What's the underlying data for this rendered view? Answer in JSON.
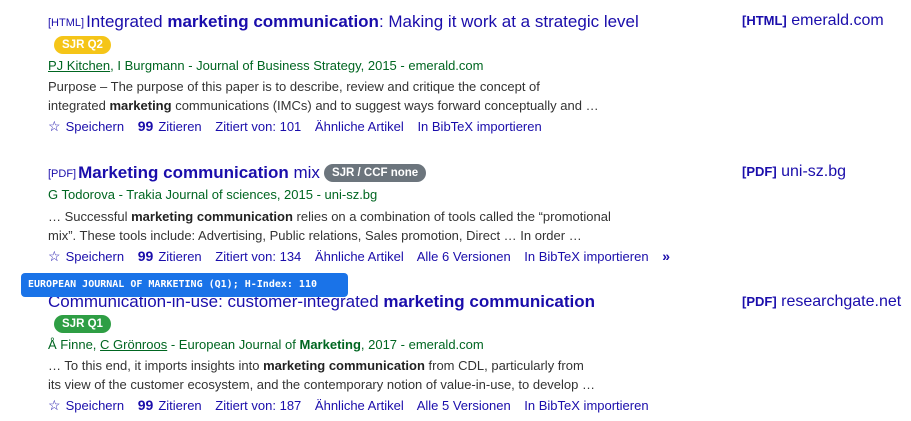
{
  "results": [
    {
      "type_tag": "[HTML]",
      "title_pre": "Integrated ",
      "title_bold": "marketing communication",
      "title_post": ": Making it work at a strategic level",
      "badge": "SJR Q2",
      "author1": "PJ Kitchen",
      "authors_rest": ", I Burgmann - Journal of Business Strategy, 2015 - emerald.com",
      "snippet_l1": "Purpose – The purpose of this paper is to describe, review and critique the concept of",
      "snippet_l2_pre": "integrated ",
      "snippet_l2_bold": "marketing",
      "snippet_l2_post": " communications (IMCs) and to suggest ways forward conceptually and …",
      "actions": {
        "save": "Speichern",
        "cite": "Zitieren",
        "cited": "Zitiert von: 101",
        "related": "Ähnliche Artikel",
        "bibtex": "In BibTeX importieren"
      },
      "side_tag": "[HTML]",
      "side_domain": "emerald.com"
    },
    {
      "type_tag": "[PDF]",
      "title_bold": "Marketing communication",
      "title_post": " mix",
      "badge": "SJR / CCF none",
      "authors": "G Todorova - Trakia Journal of sciences, 2015 - uni-sz.bg",
      "snippet_l1_pre": "… Successful ",
      "snippet_l1_bold": "marketing communication",
      "snippet_l1_post": " relies on a combination of tools called the “promotional",
      "snippet_l2": "mix”. These tools include: Advertising, Public relations, Sales promotion, Direct … In order …",
      "actions": {
        "save": "Speichern",
        "cite": "Zitieren",
        "cited": "Zitiert von: 134",
        "related": "Ähnliche Artikel",
        "versions": "Alle 6 Versionen",
        "bibtex": "In BibTeX importieren"
      },
      "side_tag": "[PDF]",
      "side_domain": "uni-sz.bg"
    },
    {
      "title_pre": "Communication-in-use: customer-integrated ",
      "title_bold": "marketing communication",
      "badge": "SJR Q1",
      "authors_pre": "Å Finne, ",
      "author2": "C Grönroos",
      "authors_mid": " - European Journal of ",
      "authors_bold": "Marketing",
      "authors_post": ", 2017 - emerald.com",
      "snippet_l1_pre": "… To this end, it imports insights into ",
      "snippet_l1_bold": "marketing communication",
      "snippet_l1_post": " from CDL, particularly from",
      "snippet_l2": "its view of the customer ecosystem, and the contemporary notion of value-in-use, to develop …",
      "actions": {
        "save": "Speichern",
        "cite": "Zitieren",
        "cited": "Zitiert von: 187",
        "related": "Ähnliche Artikel",
        "versions": "Alle 5 Versionen",
        "bibtex": "In BibTeX importieren"
      },
      "side_tag": "[PDF]",
      "side_domain": "researchgate.net"
    }
  ],
  "tooltip": "EUROPEAN JOURNAL OF MARKETING (Q1); H-Index: 110",
  "colors": {
    "link": "#1a0dab",
    "green": "#006621",
    "badge_q2": "#f5c518",
    "badge_none": "#6c757d",
    "badge_q1": "#2e9e44",
    "tooltip": "#1a73e8"
  },
  "icons": {
    "save": "star-icon",
    "cite": "quote-icon",
    "more": "double-chevron-icon"
  }
}
